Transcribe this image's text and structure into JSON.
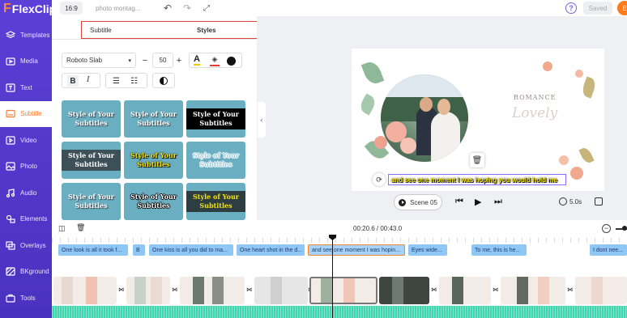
{
  "app": {
    "logo": "FlexClip",
    "ratio": "16:9",
    "project_title": "photo montag...",
    "saved": "Saved",
    "avatar": "E"
  },
  "sidebar": {
    "items": [
      {
        "label": "Templates",
        "icon": "templates-icon"
      },
      {
        "label": "Media",
        "icon": "media-icon"
      },
      {
        "label": "Text",
        "icon": "text-icon"
      },
      {
        "label": "Subtitle",
        "icon": "subtitle-icon",
        "active": true
      },
      {
        "label": "Video",
        "icon": "video-icon"
      },
      {
        "label": "Photo",
        "icon": "photo-icon"
      },
      {
        "label": "Audio",
        "icon": "audio-icon"
      },
      {
        "label": "Elements",
        "icon": "elements-icon"
      },
      {
        "label": "Overlays",
        "icon": "overlays-icon"
      },
      {
        "label": "BKground",
        "icon": "background-icon"
      },
      {
        "label": "Tools",
        "icon": "tools-icon"
      }
    ]
  },
  "panel": {
    "tab_subtitle": "Subtitle",
    "tab_styles": "Styles",
    "font": "Roboto Slab",
    "font_size": "50",
    "styles": [
      {
        "text": "Style of Your Subtitles",
        "variant": "plain"
      },
      {
        "text": "Style of Your Subtitles",
        "variant": "plain"
      },
      {
        "text": "Style of Your Subtitles",
        "variant": "blackbox"
      },
      {
        "text": "Style of Your Subtitles",
        "variant": "darkbox"
      },
      {
        "text": "Style of Your Subtitles",
        "variant": "yellow"
      },
      {
        "text": "Style of Your Subtitles",
        "variant": "outline"
      },
      {
        "text": "Style of Your Subtitles",
        "variant": "plain"
      },
      {
        "text": "Style of Your Subtitles",
        "variant": "white-outline"
      },
      {
        "text": "Style of Your Subtitles",
        "variant": "yellowbox"
      }
    ]
  },
  "preview": {
    "romance": "ROMANCE",
    "lovely": "Lovely",
    "subtitle_text": "and see one moment I was hoping you would hold me",
    "scene": "Scene",
    "scene_num": "05",
    "duration": "5.0s"
  },
  "timeline": {
    "time": "00:20.6 / 00:43.0",
    "subtitles": [
      "One look is all it took f...",
      "B",
      "One kiss is all you did to ma...",
      "One heart shot in the d...",
      "and see one moment I was hopin...",
      "Eyes wide...",
      "To me, this is he...",
      "I dont nee..."
    ]
  },
  "colors": {
    "brand": "#5b3fd6",
    "accent": "#ff7a2e",
    "subtitle_chip": "#8ec6f4",
    "audio": "#42d6b0",
    "style_card": "#6aaec2"
  }
}
